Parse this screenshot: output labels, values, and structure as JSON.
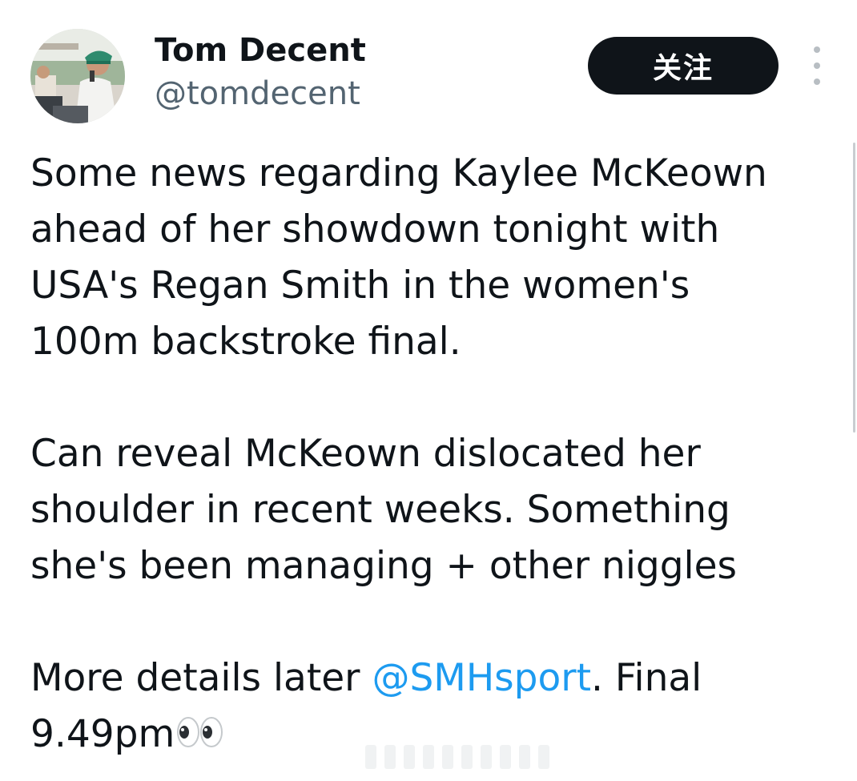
{
  "author": {
    "display_name": "Tom Decent",
    "handle": "@tomdecent",
    "avatar_icon": "profile-photo"
  },
  "actions": {
    "follow_label": "关注",
    "more_icon": "more-vertical-icon"
  },
  "tweet": {
    "line1": "Some news regarding Kaylee McKeown",
    "line2": "ahead of her showdown tonight with",
    "line3": "USA's Regan Smith in the women's",
    "line4": "100m backstroke final.",
    "line5": "Can reveal McKeown dislocated her",
    "line6": "shoulder in recent weeks. Something",
    "line7": "she's been managing + other niggles",
    "line8_prefix": "More details later ",
    "mention": "@SMHsport",
    "line8_suffix": ". Final",
    "line9": "9.49pm",
    "emoji_icon": "eyes-emoji"
  },
  "colors": {
    "text": "#0f1419",
    "secondary": "#536471",
    "link": "#1d9bf0",
    "button_bg": "#0f1419"
  }
}
